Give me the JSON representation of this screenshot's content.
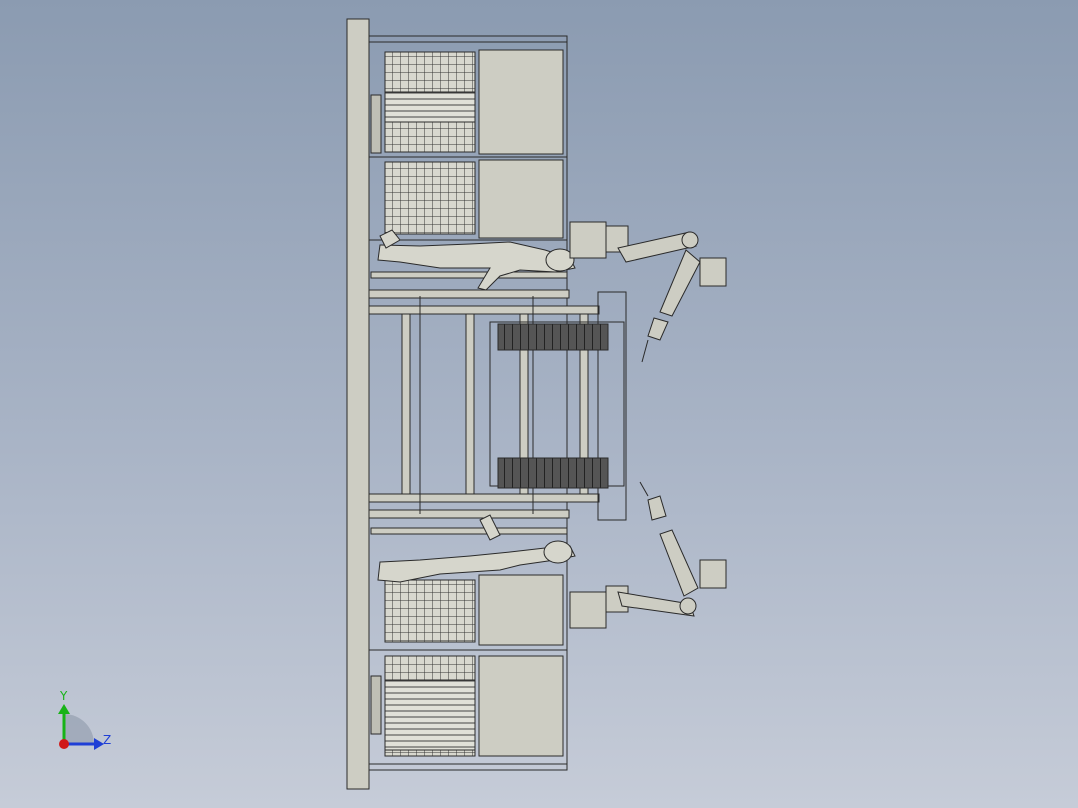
{
  "view": {
    "type": "CAD orthographic side view",
    "background_top": "#8b9bb1",
    "background_bottom": "#c6ccd8",
    "part_fill": "#cdcdc3",
    "part_stroke": "#2a2a2a",
    "belt_fill": "#4a4a4a"
  },
  "triad": {
    "y_label": "Y",
    "z_label": "Z",
    "y_color": "#17b317",
    "z_color": "#1f3fd6",
    "origin_color": "#d01818"
  }
}
